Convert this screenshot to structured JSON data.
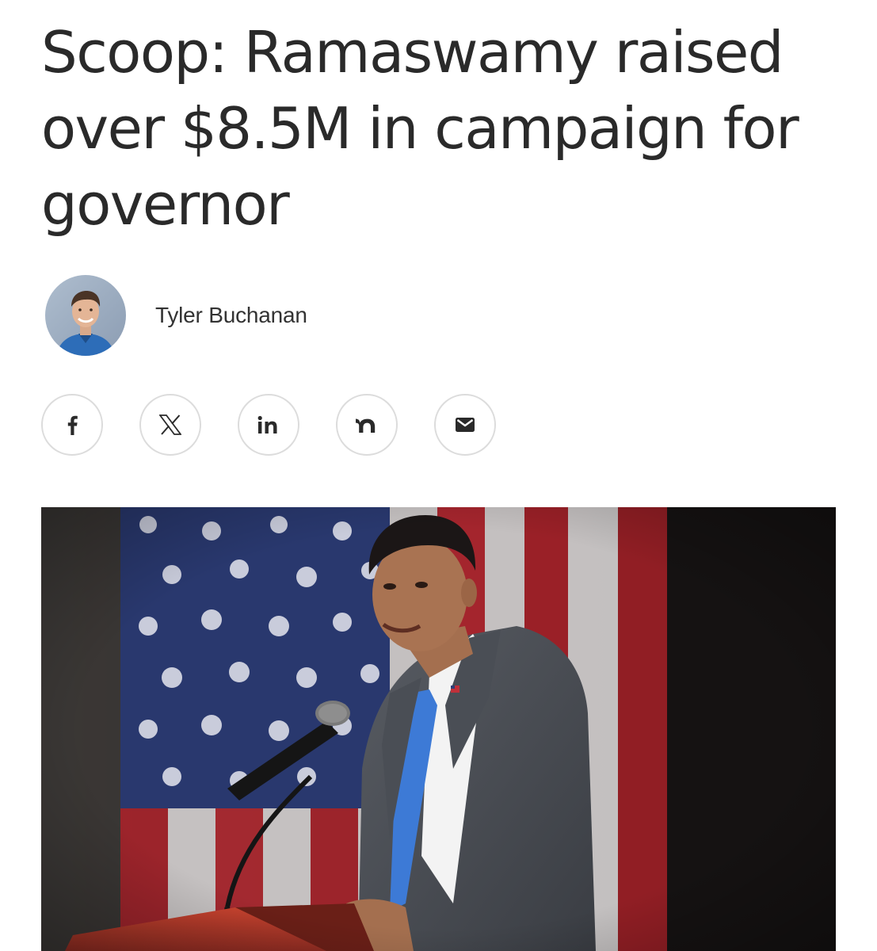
{
  "article": {
    "headline": "Scoop: Ramaswamy raised over $8.5M in campaign for governor",
    "author": {
      "name": "Tyler Buchanan",
      "avatar_icon": "author-headshot"
    }
  },
  "share": {
    "buttons": [
      {
        "name": "facebook",
        "icon": "facebook-icon"
      },
      {
        "name": "x",
        "icon": "x-icon"
      },
      {
        "name": "linkedin",
        "icon": "linkedin-icon"
      },
      {
        "name": "nextdoor",
        "icon": "nextdoor-icon"
      },
      {
        "name": "email",
        "icon": "mail-icon"
      }
    ]
  },
  "hero_image": {
    "subject": "speaker-at-podium-with-flag"
  },
  "colors": {
    "text": "#2a2a2a",
    "border": "#dcdcdc",
    "flag_red": "#b3242e",
    "flag_blue": "#2e3f78"
  }
}
